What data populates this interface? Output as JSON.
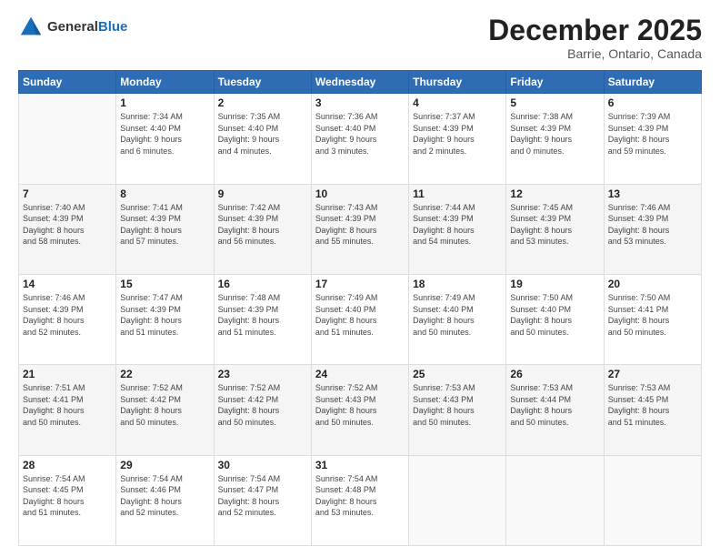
{
  "header": {
    "logo_general": "General",
    "logo_blue": "Blue",
    "month": "December 2025",
    "location": "Barrie, Ontario, Canada"
  },
  "weekdays": [
    "Sunday",
    "Monday",
    "Tuesday",
    "Wednesday",
    "Thursday",
    "Friday",
    "Saturday"
  ],
  "weeks": [
    [
      {
        "day": "",
        "info": ""
      },
      {
        "day": "1",
        "info": "Sunrise: 7:34 AM\nSunset: 4:40 PM\nDaylight: 9 hours\nand 6 minutes."
      },
      {
        "day": "2",
        "info": "Sunrise: 7:35 AM\nSunset: 4:40 PM\nDaylight: 9 hours\nand 4 minutes."
      },
      {
        "day": "3",
        "info": "Sunrise: 7:36 AM\nSunset: 4:40 PM\nDaylight: 9 hours\nand 3 minutes."
      },
      {
        "day": "4",
        "info": "Sunrise: 7:37 AM\nSunset: 4:39 PM\nDaylight: 9 hours\nand 2 minutes."
      },
      {
        "day": "5",
        "info": "Sunrise: 7:38 AM\nSunset: 4:39 PM\nDaylight: 9 hours\nand 0 minutes."
      },
      {
        "day": "6",
        "info": "Sunrise: 7:39 AM\nSunset: 4:39 PM\nDaylight: 8 hours\nand 59 minutes."
      }
    ],
    [
      {
        "day": "7",
        "info": "Sunrise: 7:40 AM\nSunset: 4:39 PM\nDaylight: 8 hours\nand 58 minutes."
      },
      {
        "day": "8",
        "info": "Sunrise: 7:41 AM\nSunset: 4:39 PM\nDaylight: 8 hours\nand 57 minutes."
      },
      {
        "day": "9",
        "info": "Sunrise: 7:42 AM\nSunset: 4:39 PM\nDaylight: 8 hours\nand 56 minutes."
      },
      {
        "day": "10",
        "info": "Sunrise: 7:43 AM\nSunset: 4:39 PM\nDaylight: 8 hours\nand 55 minutes."
      },
      {
        "day": "11",
        "info": "Sunrise: 7:44 AM\nSunset: 4:39 PM\nDaylight: 8 hours\nand 54 minutes."
      },
      {
        "day": "12",
        "info": "Sunrise: 7:45 AM\nSunset: 4:39 PM\nDaylight: 8 hours\nand 53 minutes."
      },
      {
        "day": "13",
        "info": "Sunrise: 7:46 AM\nSunset: 4:39 PM\nDaylight: 8 hours\nand 53 minutes."
      }
    ],
    [
      {
        "day": "14",
        "info": "Sunrise: 7:46 AM\nSunset: 4:39 PM\nDaylight: 8 hours\nand 52 minutes."
      },
      {
        "day": "15",
        "info": "Sunrise: 7:47 AM\nSunset: 4:39 PM\nDaylight: 8 hours\nand 51 minutes."
      },
      {
        "day": "16",
        "info": "Sunrise: 7:48 AM\nSunset: 4:39 PM\nDaylight: 8 hours\nand 51 minutes."
      },
      {
        "day": "17",
        "info": "Sunrise: 7:49 AM\nSunset: 4:40 PM\nDaylight: 8 hours\nand 51 minutes."
      },
      {
        "day": "18",
        "info": "Sunrise: 7:49 AM\nSunset: 4:40 PM\nDaylight: 8 hours\nand 50 minutes."
      },
      {
        "day": "19",
        "info": "Sunrise: 7:50 AM\nSunset: 4:40 PM\nDaylight: 8 hours\nand 50 minutes."
      },
      {
        "day": "20",
        "info": "Sunrise: 7:50 AM\nSunset: 4:41 PM\nDaylight: 8 hours\nand 50 minutes."
      }
    ],
    [
      {
        "day": "21",
        "info": "Sunrise: 7:51 AM\nSunset: 4:41 PM\nDaylight: 8 hours\nand 50 minutes."
      },
      {
        "day": "22",
        "info": "Sunrise: 7:52 AM\nSunset: 4:42 PM\nDaylight: 8 hours\nand 50 minutes."
      },
      {
        "day": "23",
        "info": "Sunrise: 7:52 AM\nSunset: 4:42 PM\nDaylight: 8 hours\nand 50 minutes."
      },
      {
        "day": "24",
        "info": "Sunrise: 7:52 AM\nSunset: 4:43 PM\nDaylight: 8 hours\nand 50 minutes."
      },
      {
        "day": "25",
        "info": "Sunrise: 7:53 AM\nSunset: 4:43 PM\nDaylight: 8 hours\nand 50 minutes."
      },
      {
        "day": "26",
        "info": "Sunrise: 7:53 AM\nSunset: 4:44 PM\nDaylight: 8 hours\nand 50 minutes."
      },
      {
        "day": "27",
        "info": "Sunrise: 7:53 AM\nSunset: 4:45 PM\nDaylight: 8 hours\nand 51 minutes."
      }
    ],
    [
      {
        "day": "28",
        "info": "Sunrise: 7:54 AM\nSunset: 4:45 PM\nDaylight: 8 hours\nand 51 minutes."
      },
      {
        "day": "29",
        "info": "Sunrise: 7:54 AM\nSunset: 4:46 PM\nDaylight: 8 hours\nand 52 minutes."
      },
      {
        "day": "30",
        "info": "Sunrise: 7:54 AM\nSunset: 4:47 PM\nDaylight: 8 hours\nand 52 minutes."
      },
      {
        "day": "31",
        "info": "Sunrise: 7:54 AM\nSunset: 4:48 PM\nDaylight: 8 hours\nand 53 minutes."
      },
      {
        "day": "",
        "info": ""
      },
      {
        "day": "",
        "info": ""
      },
      {
        "day": "",
        "info": ""
      }
    ]
  ]
}
